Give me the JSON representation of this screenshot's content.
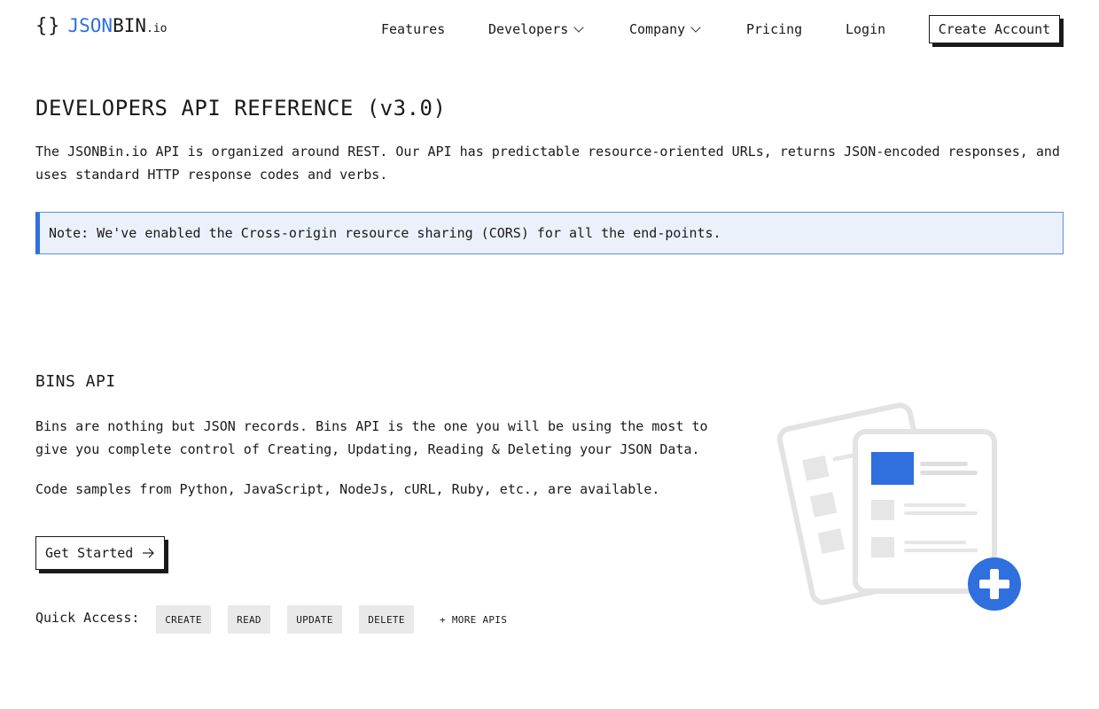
{
  "header": {
    "logo": {
      "braces": "{}",
      "json": "JSON",
      "bin": "BIN",
      "io": ".io"
    },
    "nav": {
      "features": "Features",
      "developers": "Developers",
      "company": "Company",
      "pricing": "Pricing",
      "login": "Login",
      "create_account": "Create Account"
    }
  },
  "intro": {
    "title": "DEVELOPERS API REFERENCE (v3.0)",
    "description": "The JSONBin.io API is organized around REST. Our API has predictable resource-oriented URLs, returns JSON-encoded responses, and uses standard HTTP response codes and verbs.",
    "note": "Note: We've enabled the Cross-origin resource sharing (CORS) for all the end-points."
  },
  "bins_api": {
    "title": "BINS API",
    "description": "Bins are nothing but JSON records. Bins API is the one you will be using the most to give you complete control of Creating, Updating, Reading & Deleting your JSON Data.",
    "samples": "Code samples from Python, JavaScript, NodeJs, cURL, Ruby, etc., are available.",
    "get_started": "Get Started",
    "quick_access": {
      "label": "Quick Access:",
      "create": "CREATE",
      "read": "READ",
      "update": "UPDATE",
      "delete": "DELETE",
      "more": "+ MORE APIS"
    }
  },
  "colors": {
    "accent": "#2f6fde",
    "note_bg": "#ebf1fb",
    "chip_bg": "#e9e9e9",
    "text": "#1a1a1a"
  },
  "icons": {
    "developers_chevron": "chevron-down-icon",
    "company_chevron": "chevron-down-icon",
    "get_started_arrow": "arrow-right-icon",
    "illustration": "documents-add-illustration"
  }
}
